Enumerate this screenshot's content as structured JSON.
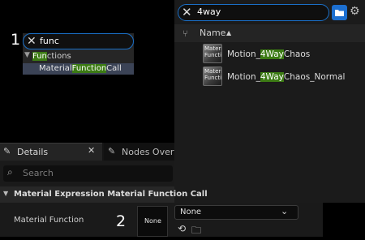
{
  "node_search": {
    "marker": "1",
    "query": "func",
    "category": {
      "match": "Fun",
      "rest": "ctions"
    },
    "result": {
      "pre": "Material",
      "match": "Function",
      "post": "Call"
    }
  },
  "content_browser": {
    "query": "4way",
    "column_name": "Name",
    "assets": [
      {
        "thumb_text": "Material Function",
        "pre": "Motion_",
        "match": "4Way",
        "post": "Chaos"
      },
      {
        "thumb_text": "Material Function",
        "pre": "Motion_",
        "match": "4Way",
        "post": "Chaos_Normal"
      }
    ]
  },
  "details": {
    "tab_label": "Details",
    "nodes_tab_label": "Nodes Overview",
    "search_placeholder": "Search",
    "section_label": "Material Expression Material Function Call",
    "property_label": "Material Function",
    "marker": "2",
    "thumb_text": "None"
  },
  "dropdown": {
    "value": "None"
  }
}
